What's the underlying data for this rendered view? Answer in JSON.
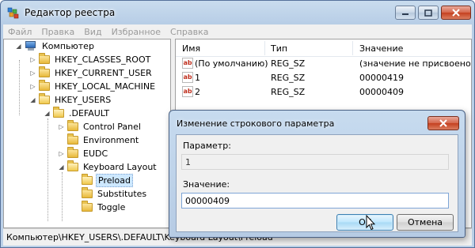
{
  "window": {
    "title": "Редактор реестра"
  },
  "menu": [
    "Файл",
    "Правка",
    "Вид",
    "Избранное",
    "Справка"
  ],
  "tree": {
    "root": "Компьютер",
    "items": [
      {
        "label": "HKEY_CLASSES_ROOT"
      },
      {
        "label": "HKEY_CURRENT_USER"
      },
      {
        "label": "HKEY_LOCAL_MACHINE"
      },
      {
        "label": "HKEY_USERS"
      },
      {
        "label": ".DEFAULT"
      },
      {
        "label": "Control Panel"
      },
      {
        "label": "Environment"
      },
      {
        "label": "EUDC"
      },
      {
        "label": "Keyboard Layout"
      },
      {
        "label": "Preload"
      },
      {
        "label": "Substitutes"
      },
      {
        "label": "Toggle"
      }
    ]
  },
  "list": {
    "columns": [
      "Имя",
      "Тип",
      "Значение"
    ],
    "rows": [
      {
        "name": "(По умолчанию)",
        "type": "REG_SZ",
        "value": "(значение не присвоено)"
      },
      {
        "name": "1",
        "type": "REG_SZ",
        "value": "00000419"
      },
      {
        "name": "2",
        "type": "REG_SZ",
        "value": "00000409"
      }
    ]
  },
  "status": {
    "path": "Компьютер\\HKEY_USERS\\.DEFAULT\\Keyboard Layout\\Preload"
  },
  "dialog": {
    "title": "Изменение строкового параметра",
    "param_label": "Параметр:",
    "param_value": "1",
    "value_label": "Значение:",
    "value_value": "00000409",
    "ok_label": "OK",
    "cancel_label": "Отмена"
  },
  "icons": {
    "value_icon": "ab-string-icon",
    "folder_icon": "folder-icon",
    "computer_icon": "computer-icon"
  }
}
